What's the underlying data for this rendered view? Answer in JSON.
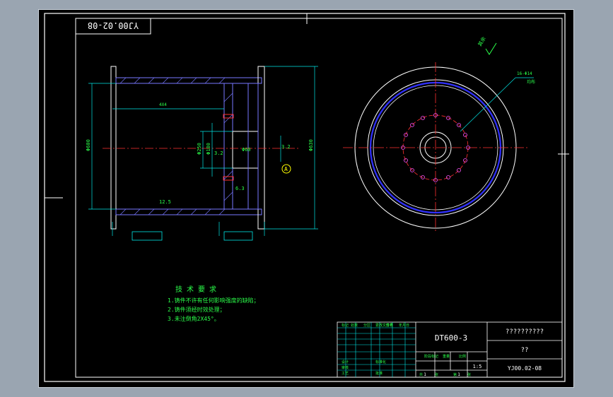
{
  "drawing": {
    "number": "YJ00.02-08",
    "number_flipped": "YJ00.02-08",
    "model": "DT600-3",
    "part_name": "??????????",
    "material": "??",
    "scale": "1:5",
    "sheet": "1",
    "sheets": "1",
    "roughness_note": "其余",
    "roughness_value": "12.5",
    "section_label": "A",
    "spec_label": "16-Φ14",
    "spec_label2": "均布"
  },
  "dimensions": {
    "d1": "Φ630",
    "d2": "Φ600",
    "d3": "Φ180",
    "d4": "Φ250",
    "d5": "4X4",
    "d6": "Φ60",
    "d7": "3.2",
    "d8": "6.3",
    "d9": "12.5",
    "d10": "3.2"
  },
  "tech_requirements": {
    "title": "技 术 要 求",
    "items": [
      "1.铸件不许有任何影响强度的缺陷；",
      "2.铸件须经时效处理；",
      "3.未注倒角2X45°。"
    ]
  },
  "title_block": {
    "labels": [
      "标记",
      "处数",
      "分区",
      "更改文件号",
      "签名",
      "年月日",
      "设计",
      "标准化",
      "审核",
      "工艺",
      "批准",
      "阶段标记",
      "重量",
      "比例",
      "共",
      "张",
      "第",
      "张"
    ]
  }
}
